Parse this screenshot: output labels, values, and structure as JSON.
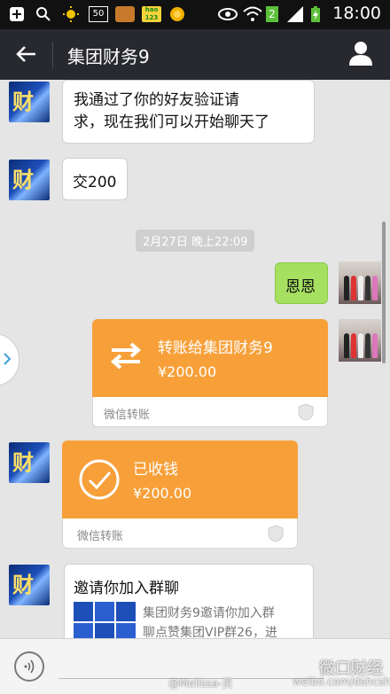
{
  "status_bar": {
    "time": "18:00",
    "icons": [
      "add-icon",
      "search-icon",
      "brightness-icon",
      "battery-50-icon",
      "game-icon",
      "hao123-icon",
      "coin-icon",
      "eye-icon",
      "wifi-icon",
      "sim-2-icon",
      "signal-icon",
      "charging-battery-icon"
    ],
    "badge_50": "50",
    "badge_2": "2",
    "hao123": "hao 123"
  },
  "header": {
    "title": "集团财务9",
    "back_icon": "back-arrow-icon",
    "profile_icon": "person-icon"
  },
  "messages": {
    "m1": {
      "line1": "我通过了你的好友验证请",
      "line2": "求，现在我们可以开始聊天了"
    },
    "m2": {
      "text": "交200"
    },
    "timestamp": "2月27日 晚上22:09",
    "m3": {
      "text": "恩恩"
    },
    "transfer_sent": {
      "title": "转账给集团财务9",
      "amount": "¥200.00",
      "footer": "微信转账"
    },
    "transfer_received": {
      "title": "已收钱",
      "amount": "¥200.00",
      "footer": "微信转账"
    },
    "invite": {
      "title": "邀请你加入群聊",
      "line1": "集团财务9邀请你加入群",
      "line2": "聊点赞集团VIP群26，进"
    }
  },
  "bottom_bar": {
    "voice_icon": "voice-icon"
  },
  "watermark": {
    "weibo": "@Melissa-灵",
    "url": "weibo.com/dshcsh",
    "brand": "微口财经"
  },
  "colors": {
    "appbar": "#27292e",
    "chat_bg": "#e5e5e5",
    "green_bubble": "#a6e060",
    "transfer_orange": "#f7a03a"
  }
}
